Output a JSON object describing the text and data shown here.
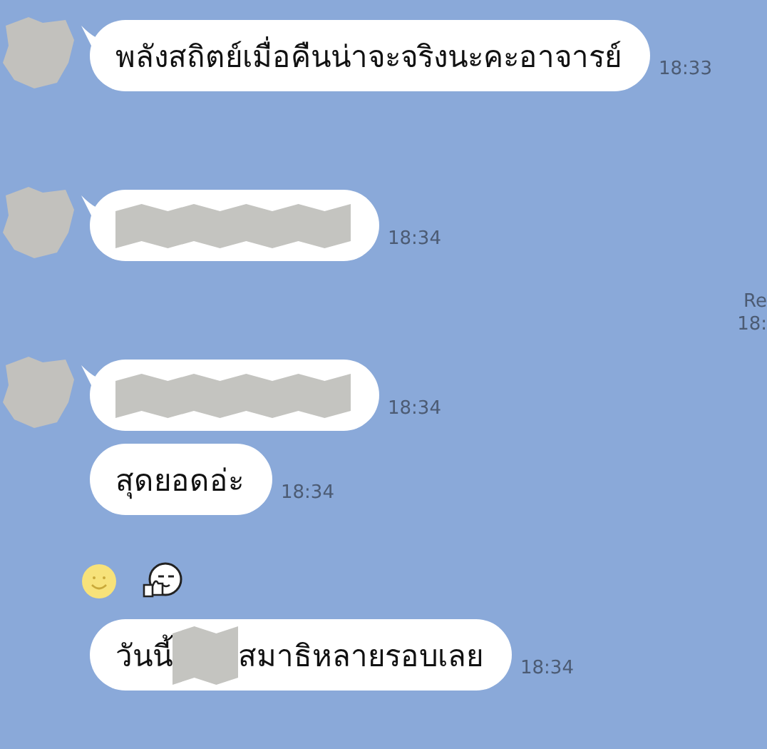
{
  "messages": [
    {
      "kind": "text",
      "show_avatar": true,
      "parts": [
        {
          "kind": "text",
          "text": "พลังสถิตย์เมื่อคืนน่าจะจริงนะคะอาจารย์"
        }
      ],
      "time": "18:33"
    },
    {
      "kind": "text",
      "show_avatar": true,
      "parts": [
        {
          "kind": "redacted"
        }
      ],
      "time": "18:34"
    },
    {
      "kind": "text",
      "show_avatar": true,
      "parts": [
        {
          "kind": "redacted"
        }
      ],
      "time": "18:34"
    },
    {
      "kind": "text",
      "show_avatar": false,
      "parts": [
        {
          "kind": "text",
          "text": "สุดยอดอ่ะ"
        }
      ],
      "time": "18:34"
    },
    {
      "kind": "emoji",
      "show_avatar": false
    },
    {
      "kind": "text",
      "show_avatar": false,
      "parts": [
        {
          "kind": "text",
          "text": "วันนี้"
        },
        {
          "kind": "redacted"
        },
        {
          "kind": "text",
          "text": "สมาธิหลายรอบเลย"
        }
      ],
      "time": "18:34"
    }
  ],
  "read_receipt": {
    "label": "Re",
    "time": "18:"
  }
}
